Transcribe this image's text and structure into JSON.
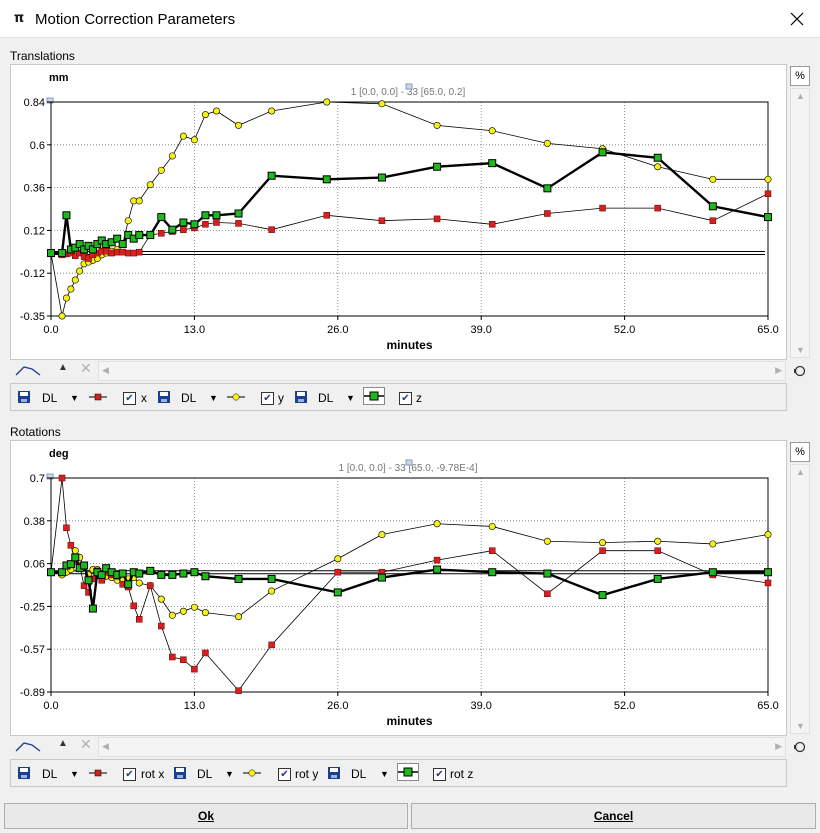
{
  "window": {
    "title": "Motion Correction Parameters",
    "icon": "pmod-logo-icon"
  },
  "translations": {
    "section_label": "Translations",
    "unit": "mm",
    "range_info": "1 [0.0, 0.0] - 33 [65.0, 0.2]",
    "percent_button": "%",
    "legend": [
      {
        "save": "DL",
        "label": "x",
        "checked": true,
        "color": "#d42020",
        "marker": "square"
      },
      {
        "save": "DL",
        "label": "y",
        "checked": true,
        "color": "#f5f015",
        "marker": "circle"
      },
      {
        "save": "DL",
        "label": "z",
        "checked": true,
        "color": "#1fb81f",
        "marker": "square-bold"
      }
    ]
  },
  "rotations": {
    "section_label": "Rotations",
    "unit": "deg",
    "range_info": "1 [0.0, 0.0] - 33 [65.0, -9.78E-4]",
    "percent_button": "%",
    "legend": [
      {
        "save": "DL",
        "label": "rot x",
        "checked": true,
        "color": "#d42020",
        "marker": "square"
      },
      {
        "save": "DL",
        "label": "rot y",
        "checked": true,
        "color": "#f5f015",
        "marker": "circle"
      },
      {
        "save": "DL",
        "label": "rot z",
        "checked": true,
        "color": "#1fb81f",
        "marker": "square-bold"
      }
    ]
  },
  "buttons": {
    "ok": "Ok",
    "cancel": "Cancel"
  },
  "chart_data": [
    {
      "type": "line",
      "xlabel": "minutes",
      "ylabel": "mm",
      "xlim": [
        0,
        65
      ],
      "ylim": [
        -0.35,
        0.84
      ],
      "xticks": [
        "0.0",
        "13.0",
        "26.0",
        "39.0",
        "52.0",
        "65.0"
      ],
      "yticks": [
        "0.84",
        "0.6",
        "0.36",
        "0.12",
        "-0.12",
        "-0.35"
      ],
      "grid": true,
      "series": [
        {
          "name": "x",
          "color": "#d42020",
          "x": [
            0,
            1,
            1.4,
            1.8,
            2.2,
            2.6,
            3,
            3.4,
            3.8,
            4.2,
            4.6,
            5,
            5.5,
            6,
            6.5,
            7,
            7.5,
            8,
            9,
            10,
            11,
            12,
            13,
            14,
            15,
            17,
            20,
            25,
            30,
            35,
            40,
            45,
            50,
            55,
            60,
            65
          ],
          "y": [
            0,
            -0.01,
            -0.005,
            0,
            -0.015,
            0,
            -0.02,
            -0.03,
            -0.01,
            0,
            0.01,
            0.01,
            0,
            0.005,
            0.005,
            0,
            0,
            0.005,
            0.1,
            0.11,
            0.12,
            0.13,
            0.14,
            0.16,
            0.17,
            0.165,
            0.13,
            0.21,
            0.18,
            0.19,
            0.16,
            0.22,
            0.25,
            0.25,
            0.18,
            0.33
          ]
        },
        {
          "name": "y",
          "color": "#f5f015",
          "x": [
            0,
            1,
            1.4,
            1.8,
            2.2,
            2.6,
            3,
            3.4,
            3.8,
            4.2,
            4.6,
            5,
            5.5,
            6,
            6.5,
            7,
            7.5,
            8,
            9,
            10,
            11,
            12,
            13,
            14,
            15,
            17,
            20,
            25,
            30,
            35,
            40,
            45,
            50,
            55,
            60,
            65
          ],
          "y": [
            0,
            -0.35,
            -0.25,
            -0.2,
            -0.15,
            -0.1,
            -0.06,
            -0.05,
            -0.04,
            -0.03,
            -0.01,
            0,
            0.01,
            0.02,
            0.05,
            0.18,
            0.29,
            0.29,
            0.38,
            0.46,
            0.54,
            0.65,
            0.63,
            0.77,
            0.79,
            0.71,
            0.79,
            0.84,
            0.83,
            0.71,
            0.68,
            0.61,
            0.58,
            0.48,
            0.41,
            0.41
          ]
        },
        {
          "name": "z",
          "color": "#1fb81f",
          "x": [
            0,
            1,
            1.4,
            1.8,
            2.2,
            2.6,
            3,
            3.4,
            3.8,
            4.2,
            4.6,
            5,
            5.5,
            6,
            6.5,
            7,
            7.5,
            8,
            9,
            10,
            11,
            12,
            13,
            14,
            15,
            17,
            20,
            25,
            30,
            35,
            40,
            45,
            50,
            55,
            60,
            65
          ],
          "y": [
            0,
            0,
            0.21,
            0.02,
            0.03,
            0.05,
            0.02,
            0.04,
            0.02,
            0.05,
            0.07,
            0.05,
            0.06,
            0.08,
            0.05,
            0.1,
            0.08,
            0.1,
            0.1,
            0.2,
            0.13,
            0.17,
            0.16,
            0.21,
            0.21,
            0.22,
            0.43,
            0.41,
            0.42,
            0.48,
            0.5,
            0.36,
            0.56,
            0.53,
            0.26,
            0.2
          ]
        }
      ]
    },
    {
      "type": "line",
      "xlabel": "minutes",
      "ylabel": "deg",
      "xlim": [
        0,
        65
      ],
      "ylim": [
        -0.89,
        0.7
      ],
      "xticks": [
        "0.0",
        "13.0",
        "26.0",
        "39.0",
        "52.0",
        "65.0"
      ],
      "yticks": [
        "0.7",
        "0.38",
        "0.06",
        "-0.25",
        "-0.57",
        "-0.89"
      ],
      "grid": true,
      "series": [
        {
          "name": "rot x",
          "color": "#d42020",
          "x": [
            0,
            1,
            1.4,
            1.8,
            2.2,
            2.6,
            3,
            3.4,
            3.8,
            4.2,
            4.6,
            5,
            5.5,
            6,
            6.5,
            7,
            7.5,
            8,
            9,
            10,
            11,
            12,
            13,
            14,
            17,
            20,
            26,
            30,
            35,
            40,
            45,
            50,
            55,
            60,
            65
          ],
          "y": [
            0,
            0.7,
            0.33,
            0.2,
            0.08,
            0.05,
            -0.1,
            -0.15,
            -0.05,
            0.01,
            -0.06,
            0,
            -0.02,
            -0.03,
            -0.09,
            -0.11,
            -0.25,
            -0.35,
            -0.1,
            -0.4,
            -0.63,
            -0.65,
            -0.72,
            -0.6,
            -0.88,
            -0.54,
            0,
            0,
            0.09,
            0.16,
            -0.16,
            0.16,
            0.16,
            -0.02,
            -0.08
          ]
        },
        {
          "name": "rot y",
          "color": "#f5f015",
          "x": [
            0,
            1,
            1.4,
            1.8,
            2.2,
            2.6,
            3,
            3.4,
            3.8,
            4.2,
            4.6,
            5,
            5.5,
            6,
            6.5,
            7,
            7.5,
            8,
            9,
            10,
            11,
            12,
            13,
            14,
            17,
            20,
            26,
            30,
            35,
            40,
            45,
            50,
            55,
            60,
            65
          ],
          "y": [
            0,
            -0.02,
            0,
            0.02,
            0.16,
            0.11,
            0.05,
            -0.02,
            0.02,
            0.02,
            -0.01,
            -0.03,
            -0.04,
            -0.06,
            -0.06,
            -0.05,
            -0.04,
            -0.08,
            -0.1,
            -0.2,
            -0.32,
            -0.29,
            -0.26,
            -0.3,
            -0.33,
            -0.14,
            0.1,
            0.28,
            0.36,
            0.34,
            0.23,
            0.22,
            0.23,
            0.21,
            0.28
          ]
        },
        {
          "name": "rot z",
          "color": "#1fb81f",
          "x": [
            0,
            1,
            1.4,
            1.8,
            2.2,
            2.6,
            3,
            3.4,
            3.8,
            4.2,
            4.6,
            5,
            5.5,
            6,
            6.5,
            7,
            7.5,
            8,
            9,
            10,
            11,
            12,
            13,
            14,
            17,
            20,
            26,
            30,
            35,
            40,
            45,
            50,
            55,
            60,
            65
          ],
          "y": [
            0,
            0,
            0.05,
            0.06,
            0.11,
            0.03,
            0.05,
            -0.06,
            -0.27,
            0,
            -0.02,
            0.03,
            0,
            -0.02,
            -0.01,
            -0.09,
            0,
            -0.01,
            0.01,
            -0.02,
            -0.02,
            -0.01,
            0,
            -0.03,
            -0.05,
            -0.05,
            -0.15,
            -0.04,
            0.02,
            0,
            -0.01,
            -0.17,
            -0.05,
            0,
            0
          ]
        }
      ]
    }
  ]
}
